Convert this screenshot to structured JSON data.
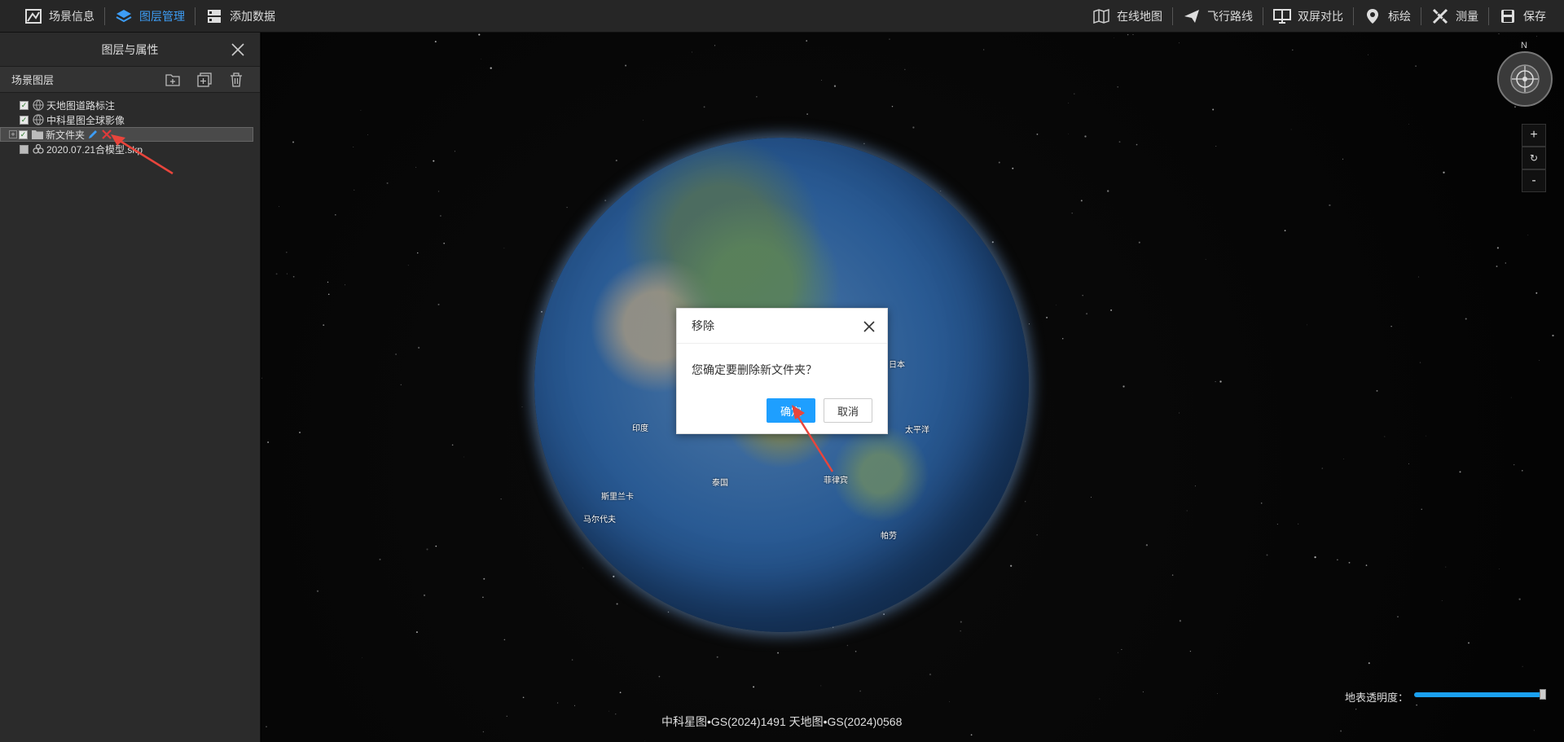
{
  "toolbar": {
    "left": [
      {
        "label": "场景信息",
        "icon": "scene-info-icon"
      },
      {
        "label": "图层管理",
        "icon": "layers-icon",
        "active": true
      },
      {
        "label": "添加数据",
        "icon": "add-data-icon"
      }
    ],
    "right": [
      {
        "label": "在线地图",
        "icon": "online-map-icon"
      },
      {
        "label": "飞行路线",
        "icon": "flight-route-icon"
      },
      {
        "label": "双屏对比",
        "icon": "dual-screen-icon"
      },
      {
        "label": "标绘",
        "icon": "plot-marker-icon"
      },
      {
        "label": "测量",
        "icon": "measure-icon"
      },
      {
        "label": "保存",
        "icon": "save-icon"
      }
    ]
  },
  "panel": {
    "title": "图层与属性",
    "section_label": "场景图层",
    "layers": [
      {
        "label": "天地图道路标注",
        "checked": true,
        "icon": "globe-layer-icon"
      },
      {
        "label": "中科星图全球影像",
        "checked": true,
        "icon": "globe-layer-icon"
      },
      {
        "label": "新文件夹",
        "checked": true,
        "icon": "folder-icon",
        "selected": true
      },
      {
        "label": "2020.07.21合模型.skp",
        "checked": false,
        "icon": "model-icon"
      }
    ]
  },
  "map": {
    "compass_north": "N",
    "zoom_in": "+",
    "reset": "↻",
    "zoom_out": "-",
    "credits": "中科星图•GS(2024)1491 天地图•GS(2024)0568",
    "opacity_label": "地表透明度：",
    "opacity_value": 1.0,
    "globe_labels": [
      "印度",
      "泰国",
      "斯里兰卡",
      "马尔代夫",
      "菲律宾",
      "日本",
      "太平洋",
      "帕劳"
    ]
  },
  "dialog": {
    "title": "移除",
    "message": "您确定要删除新文件夹？",
    "ok_label": "确定",
    "cancel_label": "取消"
  },
  "colors": {
    "accent": "#1e9fff",
    "active_tab": "#3d9df5",
    "annotation_arrow": "#e8453c"
  }
}
